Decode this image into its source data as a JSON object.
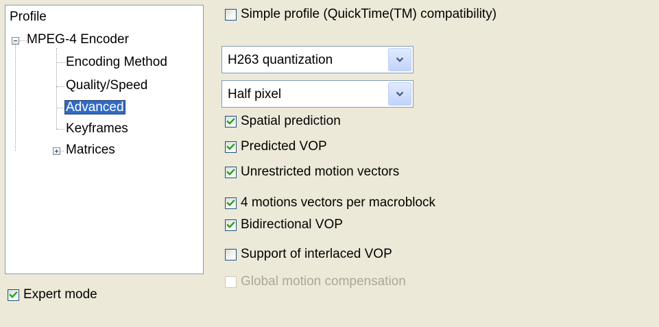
{
  "tree": {
    "root_label": "Profile",
    "encoder_label": "MPEG-4 Encoder",
    "items": [
      {
        "label": "Encoding Method"
      },
      {
        "label": "Quality/Speed"
      },
      {
        "label": "Advanced",
        "selected": true
      },
      {
        "label": "Keyframes"
      },
      {
        "label": "Matrices",
        "collapsed": true
      }
    ]
  },
  "expert_mode": {
    "label": "Expert mode",
    "checked": true
  },
  "options": {
    "simple_profile": {
      "label": "Simple profile (QuickTime(TM) compatibility)",
      "checked": false
    },
    "quantization": {
      "selected": "H263 quantization"
    },
    "pixel_mode": {
      "selected": "Half pixel"
    },
    "checkboxes": [
      {
        "label": "Spatial prediction",
        "checked": true,
        "enabled": true
      },
      {
        "label": "Predicted VOP",
        "checked": true,
        "enabled": true
      },
      {
        "label": "Unrestricted motion vectors",
        "checked": true,
        "enabled": true
      },
      {
        "label": "4 motions vectors per macroblock",
        "checked": true,
        "enabled": true
      },
      {
        "label": "Bidirectional VOP",
        "checked": true,
        "enabled": true
      },
      {
        "label": "Support of interlaced VOP",
        "checked": false,
        "enabled": true
      },
      {
        "label": "Global motion compensation",
        "checked": false,
        "enabled": false
      }
    ]
  },
  "colors": {
    "background": "#ECE9D8",
    "selection": "#316AC5",
    "check": "#21A121",
    "disabled_text": "#ACA899"
  }
}
